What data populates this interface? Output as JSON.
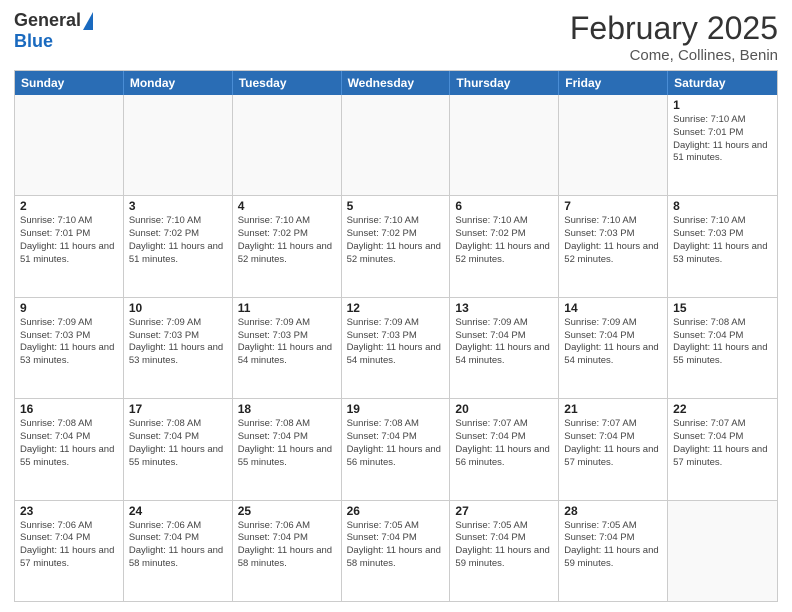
{
  "header": {
    "logo_general": "General",
    "logo_blue": "Blue",
    "month_title": "February 2025",
    "location": "Come, Collines, Benin"
  },
  "calendar": {
    "days_of_week": [
      "Sunday",
      "Monday",
      "Tuesday",
      "Wednesday",
      "Thursday",
      "Friday",
      "Saturday"
    ],
    "weeks": [
      [
        {
          "day": "",
          "info": ""
        },
        {
          "day": "",
          "info": ""
        },
        {
          "day": "",
          "info": ""
        },
        {
          "day": "",
          "info": ""
        },
        {
          "day": "",
          "info": ""
        },
        {
          "day": "",
          "info": ""
        },
        {
          "day": "1",
          "info": "Sunrise: 7:10 AM\nSunset: 7:01 PM\nDaylight: 11 hours and 51 minutes."
        }
      ],
      [
        {
          "day": "2",
          "info": "Sunrise: 7:10 AM\nSunset: 7:01 PM\nDaylight: 11 hours and 51 minutes."
        },
        {
          "day": "3",
          "info": "Sunrise: 7:10 AM\nSunset: 7:02 PM\nDaylight: 11 hours and 51 minutes."
        },
        {
          "day": "4",
          "info": "Sunrise: 7:10 AM\nSunset: 7:02 PM\nDaylight: 11 hours and 52 minutes."
        },
        {
          "day": "5",
          "info": "Sunrise: 7:10 AM\nSunset: 7:02 PM\nDaylight: 11 hours and 52 minutes."
        },
        {
          "day": "6",
          "info": "Sunrise: 7:10 AM\nSunset: 7:02 PM\nDaylight: 11 hours and 52 minutes."
        },
        {
          "day": "7",
          "info": "Sunrise: 7:10 AM\nSunset: 7:03 PM\nDaylight: 11 hours and 52 minutes."
        },
        {
          "day": "8",
          "info": "Sunrise: 7:10 AM\nSunset: 7:03 PM\nDaylight: 11 hours and 53 minutes."
        }
      ],
      [
        {
          "day": "9",
          "info": "Sunrise: 7:09 AM\nSunset: 7:03 PM\nDaylight: 11 hours and 53 minutes."
        },
        {
          "day": "10",
          "info": "Sunrise: 7:09 AM\nSunset: 7:03 PM\nDaylight: 11 hours and 53 minutes."
        },
        {
          "day": "11",
          "info": "Sunrise: 7:09 AM\nSunset: 7:03 PM\nDaylight: 11 hours and 54 minutes."
        },
        {
          "day": "12",
          "info": "Sunrise: 7:09 AM\nSunset: 7:03 PM\nDaylight: 11 hours and 54 minutes."
        },
        {
          "day": "13",
          "info": "Sunrise: 7:09 AM\nSunset: 7:04 PM\nDaylight: 11 hours and 54 minutes."
        },
        {
          "day": "14",
          "info": "Sunrise: 7:09 AM\nSunset: 7:04 PM\nDaylight: 11 hours and 54 minutes."
        },
        {
          "day": "15",
          "info": "Sunrise: 7:08 AM\nSunset: 7:04 PM\nDaylight: 11 hours and 55 minutes."
        }
      ],
      [
        {
          "day": "16",
          "info": "Sunrise: 7:08 AM\nSunset: 7:04 PM\nDaylight: 11 hours and 55 minutes."
        },
        {
          "day": "17",
          "info": "Sunrise: 7:08 AM\nSunset: 7:04 PM\nDaylight: 11 hours and 55 minutes."
        },
        {
          "day": "18",
          "info": "Sunrise: 7:08 AM\nSunset: 7:04 PM\nDaylight: 11 hours and 55 minutes."
        },
        {
          "day": "19",
          "info": "Sunrise: 7:08 AM\nSunset: 7:04 PM\nDaylight: 11 hours and 56 minutes."
        },
        {
          "day": "20",
          "info": "Sunrise: 7:07 AM\nSunset: 7:04 PM\nDaylight: 11 hours and 56 minutes."
        },
        {
          "day": "21",
          "info": "Sunrise: 7:07 AM\nSunset: 7:04 PM\nDaylight: 11 hours and 57 minutes."
        },
        {
          "day": "22",
          "info": "Sunrise: 7:07 AM\nSunset: 7:04 PM\nDaylight: 11 hours and 57 minutes."
        }
      ],
      [
        {
          "day": "23",
          "info": "Sunrise: 7:06 AM\nSunset: 7:04 PM\nDaylight: 11 hours and 57 minutes."
        },
        {
          "day": "24",
          "info": "Sunrise: 7:06 AM\nSunset: 7:04 PM\nDaylight: 11 hours and 58 minutes."
        },
        {
          "day": "25",
          "info": "Sunrise: 7:06 AM\nSunset: 7:04 PM\nDaylight: 11 hours and 58 minutes."
        },
        {
          "day": "26",
          "info": "Sunrise: 7:05 AM\nSunset: 7:04 PM\nDaylight: 11 hours and 58 minutes."
        },
        {
          "day": "27",
          "info": "Sunrise: 7:05 AM\nSunset: 7:04 PM\nDaylight: 11 hours and 59 minutes."
        },
        {
          "day": "28",
          "info": "Sunrise: 7:05 AM\nSunset: 7:04 PM\nDaylight: 11 hours and 59 minutes."
        },
        {
          "day": "",
          "info": ""
        }
      ]
    ]
  }
}
